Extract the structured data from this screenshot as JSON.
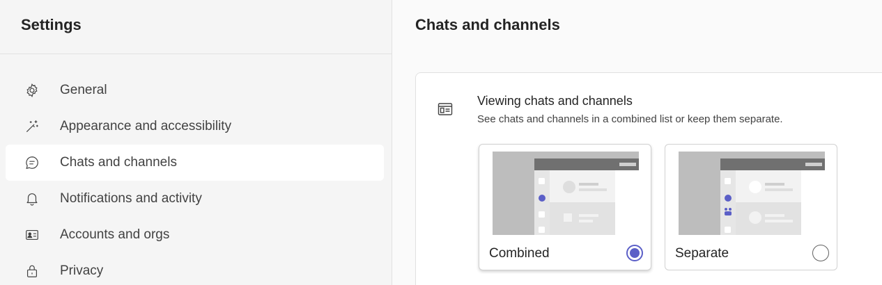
{
  "sidebar": {
    "title": "Settings",
    "items": [
      {
        "label": "General",
        "icon": "gear-icon",
        "selected": false
      },
      {
        "label": "Appearance and accessibility",
        "icon": "magic-wand-icon",
        "selected": false
      },
      {
        "label": "Chats and channels",
        "icon": "chat-bubble-icon",
        "selected": true
      },
      {
        "label": "Notifications and activity",
        "icon": "bell-icon",
        "selected": false
      },
      {
        "label": "Accounts and orgs",
        "icon": "contact-card-icon",
        "selected": false
      },
      {
        "label": "Privacy",
        "icon": "lock-icon",
        "selected": false
      }
    ]
  },
  "main": {
    "title": "Chats and channels",
    "section": {
      "icon": "window-list-icon",
      "title": "Viewing chats and channels",
      "description": "See chats and channels in a combined list or keep them separate.",
      "options": [
        {
          "label": "Combined",
          "selected": true
        },
        {
          "label": "Separate",
          "selected": false
        }
      ]
    }
  },
  "colors": {
    "accent": "#5b5fc7",
    "selected_bg": "#ffffff",
    "sidebar_bg": "#f5f5f5"
  }
}
